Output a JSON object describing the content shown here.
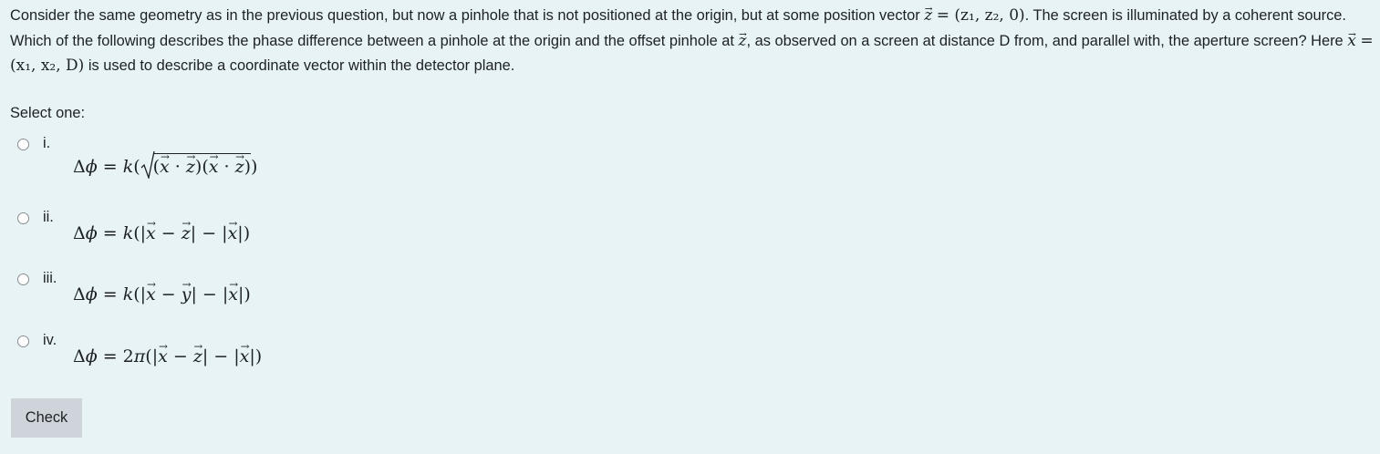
{
  "question": {
    "seg1": "Consider the same geometry as in the previous question, but now a pinhole that is not positioned at the origin, but at some position vector ",
    "seg2": ". The screen is illuminated by a coherent source. Which of the following describes the phase difference between a pinhole at the origin and the offset pinhole at ",
    "seg3": ", as observed on a screen at distance D from, and parallel with, the aperture screen? Here ",
    "seg4": " is used to describe a coordinate vector within the detector plane.",
    "vec_z_def": "= (z₁, z₂, 0)",
    "vec_x_def": "= (x₁, x₂, D)"
  },
  "prompt": "Select one:",
  "options": [
    {
      "number": "i.",
      "formula": "Δϕ = k(√((x⃗ · z⃗)(x⃗ · z⃗)))"
    },
    {
      "number": "ii.",
      "formula": "Δϕ = k(|x⃗ − z⃗| − |x⃗|)"
    },
    {
      "number": "iii.",
      "formula": "Δϕ = k(|x⃗ − y⃗| − |x⃗|)"
    },
    {
      "number": "iv.",
      "formula": "Δϕ = 2π(|x⃗ − z⃗| − |x⃗|)"
    }
  ],
  "check_label": "Check"
}
